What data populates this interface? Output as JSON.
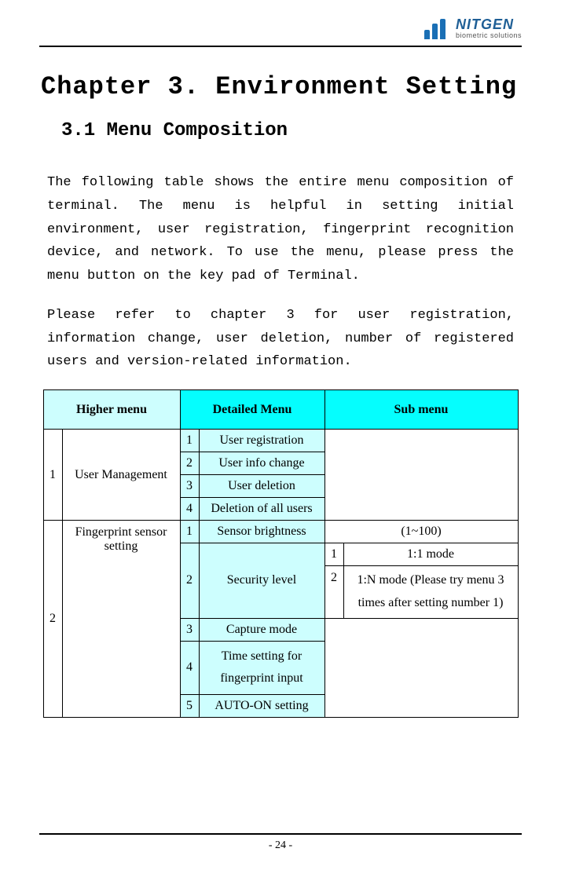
{
  "logo": {
    "brand": "NITGEN",
    "tagline": "biometric solutions"
  },
  "chapter_title": "Chapter 3. Environment Setting",
  "section_title": "3.1 Menu Composition",
  "paragraph1": "The following table shows the entire menu composition of terminal. The menu is helpful in setting initial environment, user registration, fingerprint recognition device, and network. To use the menu, please press the menu button on the key pad of Terminal.",
  "paragraph2": "Please refer to chapter 3 for user registration, information change, user deletion, number of registered users and version-related information.",
  "table": {
    "headers": {
      "higher": "Higher menu",
      "detailed": "Detailed Menu",
      "sub": "Sub menu"
    },
    "rows": {
      "h1_num": "1",
      "h1_name": "User Management",
      "h1_d1_num": "1",
      "h1_d1": "User registration",
      "h1_d2_num": "2",
      "h1_d2": "User info change",
      "h1_d3_num": "3",
      "h1_d3": "User deletion",
      "h1_d4_num": "4",
      "h1_d4": "Deletion of all users",
      "h2_num": "2",
      "h2_name": "Fingerprint sensor setting",
      "h2_d1_num": "1",
      "h2_d1": "Sensor brightness",
      "h2_d1_sub": "(1~100)",
      "h2_d2_num": "2",
      "h2_d2": "Security level",
      "h2_d2_s1_num": "1",
      "h2_d2_s1": "1:1 mode",
      "h2_d2_s2_num": "2",
      "h2_d2_s2": "1:N mode (Please try menu 3 times after setting number 1)",
      "h2_d3_num": "3",
      "h2_d3": "Capture mode",
      "h2_d4_num": "4",
      "h2_d4": "Time setting for fingerprint input",
      "h2_d5_num": "5",
      "h2_d5": "AUTO-ON setting"
    }
  },
  "page_number": "- 24 -"
}
